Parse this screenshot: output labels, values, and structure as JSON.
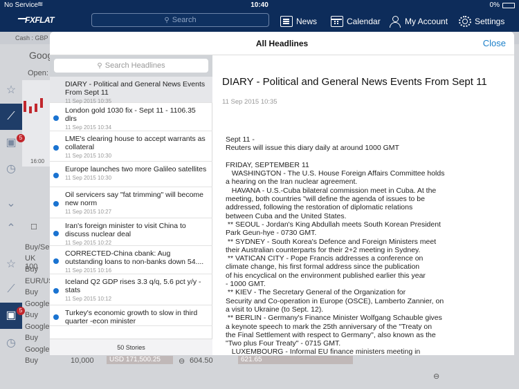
{
  "status_bar": {
    "carrier": "No Service",
    "time": "10:40",
    "battery": "0%"
  },
  "nav": {
    "logo": "FXFLAT",
    "search_placeholder": "Search",
    "items": [
      {
        "label": "News",
        "icon": "news-icon"
      },
      {
        "label": "Calendar",
        "icon": "calendar-icon"
      },
      {
        "label": "My Account",
        "icon": "user-icon"
      },
      {
        "label": "Settings",
        "icon": "gear-icon"
      }
    ]
  },
  "background": {
    "cash_label": "Cash : GBP",
    "instrument": "Goog",
    "open_label": "Open:",
    "chart_time": "16:00",
    "badge_count": "5",
    "buysell_header": "Buy/Se",
    "rows": [
      {
        "name": "UK 100",
        "side": "Buy"
      },
      {
        "name": "EUR/US",
        "side": "Buy"
      },
      {
        "name": "Google",
        "side": "Buy"
      },
      {
        "name": "Google",
        "side": "Buy"
      },
      {
        "name": "Google",
        "side": "Buy"
      }
    ],
    "bottom_qty": "10,000",
    "bottom_value": "USD 171,500.25",
    "bottom_price": "604.50",
    "bottom_other": "621.65"
  },
  "modal": {
    "title": "All Headlines",
    "close_label": "Close",
    "search_placeholder": "Search Headlines",
    "footer": "50 Stories",
    "headlines": [
      {
        "title": "DIARY - Political and General News Events From Sept 11",
        "time": "11 Sep 2015 10:35",
        "unread": false
      },
      {
        "title": "London gold 1030 fix - Sept 11 - 1106.35 dlrs",
        "time": "11 Sep 2015 10:34",
        "unread": true
      },
      {
        "title": "LME's clearing house to accept warrants as collateral",
        "time": "11 Sep 2015 10:30",
        "unread": true
      },
      {
        "title": "Europe launches two more Galileo satellites",
        "time": "11 Sep 2015 10:30",
        "unread": true
      },
      {
        "title": "Oil servicers say \"fat trimming\" will become new norm",
        "time": "11 Sep 2015 10:27",
        "unread": true
      },
      {
        "title": "Iran's foreign minister to visit China to discuss nuclear deal",
        "time": "11 Sep 2015 10:22",
        "unread": true
      },
      {
        "title": "CORRECTED-China cbank: Aug outstanding loans to non-banks down 54....",
        "time": "11 Sep 2015 10:16",
        "unread": true
      },
      {
        "title": "Iceland Q2 GDP rises 3.3 q/q, 5.6 pct y/y - stats",
        "time": "11 Sep 2015 10:12",
        "unread": true
      },
      {
        "title": "Turkey's economic growth to slow in third quarter -econ minister",
        "time": "",
        "unread": true
      }
    ],
    "article": {
      "title": "DIARY - Political and General News Events From Sept 11",
      "date": "11 Sep 2015 10:35",
      "body": "Sept 11 -\nReuters will issue this diary daily at around 1000 GMT\n\nFRIDAY, SEPTEMBER 11\n   WASHINGTON - The U.S. House Foreign Affairs Committee holds\na hearing on the Iran nuclear agreement.\n   HAVANA - U.S.-Cuba bilateral commission meet in Cuba. At the\nmeeting, both countries \"will define the agenda of issues to be\naddressed, following the restoration of diplomatic relations\nbetween Cuba and the United States.\n ** SEOUL - Jordan's King Abdullah meets South Korean President\nPark Geun-hye - 0730 GMT.\n ** SYDNEY - South Korea's Defence and Foreign Ministers meet\ntheir Australian counterparts for their 2+2 meeting in Sydney.\n ** VATICAN CITY - Pope Francis addresses a conference on\nclimate change, his first formal address since the publication\nof his encyclical on the environment published earlier this year\n- 1000 GMT.\n ** KIEV - The Secretary General of the Organization for\nSecurity and Co-operation in Europe (OSCE), Lamberto Zannier, on\na visit to Ukraine (to Sept. 12).\n ** BERLIN - Germany's Finance Minister Wolfgang Schauble gives\na keynote speech to mark the 25th anniversary of the \"Treaty on\nthe Final Settlement with respect to Germany\", also known as the\n\"Two plus Four Treaty\" - 0715 GMT.\n   LUXEMBOURG - Informal EU finance ministers meeting in"
    }
  }
}
